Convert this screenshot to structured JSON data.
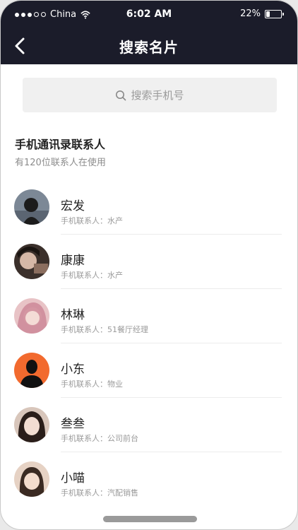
{
  "status_bar": {
    "carrier": "China",
    "time": "6:02 AM",
    "battery": "22%",
    "battery_level": 0.22
  },
  "nav": {
    "title": "搜索名片",
    "back_icon": "chevron-left-icon"
  },
  "search": {
    "placeholder": "搜索手机号",
    "icon": "search-icon"
  },
  "section": {
    "title": "手机通讯录联系人",
    "subtitle": "有120位联系人在使用"
  },
  "contacts": [
    {
      "name": "宏发",
      "desc": "手机联系人：水产",
      "avatar_color": "#6f7d8c"
    },
    {
      "name": "康康",
      "desc": "手机联系人：水产",
      "avatar_color": "#5e4a40"
    },
    {
      "name": "林琳",
      "desc": "手机联系人：51餐厅经理",
      "avatar_color": "#d9a2a6"
    },
    {
      "name": "小东",
      "desc": "手机联系人：物业",
      "avatar_color": "#f26a2e"
    },
    {
      "name": "叁叁",
      "desc": "手机联系人：公司前台",
      "avatar_color": "#b79a8a"
    },
    {
      "name": "小喵",
      "desc": "手机联系人：汽配销售",
      "avatar_color": "#caa58f"
    }
  ],
  "colors": {
    "header_bg": "#1b1c2a",
    "search_bg": "#f0f0f0"
  }
}
